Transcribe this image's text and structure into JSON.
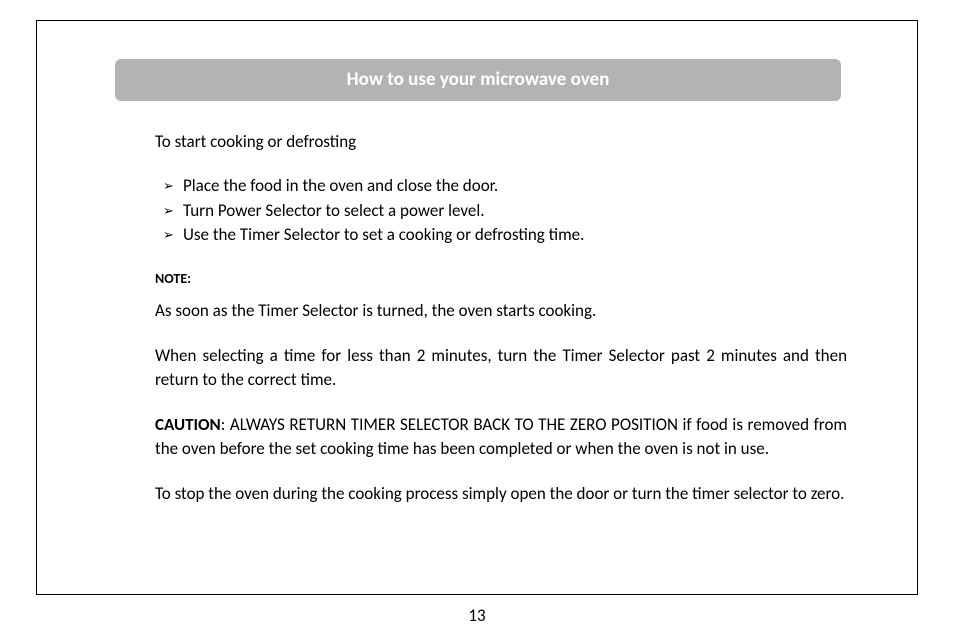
{
  "header": {
    "title": "How to use your microwave oven"
  },
  "intro": "To start cooking or defrosting",
  "bullets": {
    "item1": "Place the food in the oven and close the door.",
    "item2": "Turn Power Selector to select a power level.",
    "item3": "Use the Timer Selector to set a cooking or defrosting time."
  },
  "note": {
    "label": "NOTE:",
    "para1": "As soon as the Timer Selector is turned, the  oven starts cooking.",
    "para2": "When selecting a time for less than 2 minutes, turn the Timer Selector past 2 minutes and then return to the correct time."
  },
  "caution": {
    "label": "CAUTION",
    "text": ": ALWAYS RETURN TIMER SELECTOR BACK TO THE  ZERO POSITION if food is removed from the  oven before the set cooking time has been completed or when the oven is not in use."
  },
  "stop": "To stop the oven during the cooking process simply open the door or turn the timer selector to zero.",
  "page_number": "13"
}
